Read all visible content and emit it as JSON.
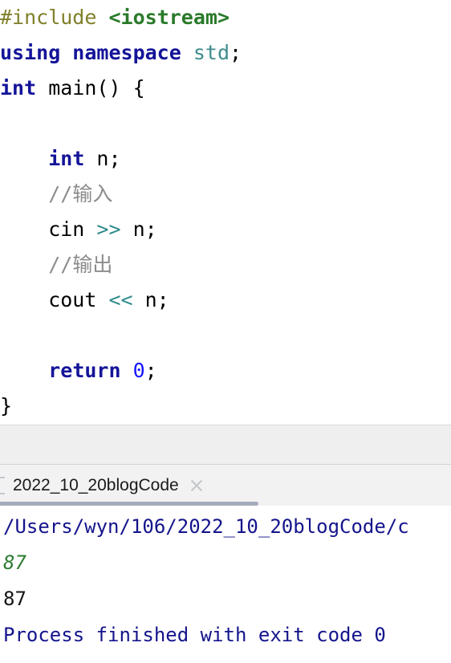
{
  "editor": {
    "language": "C++",
    "lines": [
      {
        "id": "line-include",
        "tokens": [
          {
            "t": "#include",
            "c": "tok-pre"
          },
          {
            "t": " ",
            "c": "tok-plain"
          },
          {
            "t": "<iostream>",
            "c": "tok-header"
          }
        ]
      },
      {
        "id": "line-using",
        "tokens": [
          {
            "t": "using namespace",
            "c": "tok-kw"
          },
          {
            "t": " ",
            "c": "tok-plain"
          },
          {
            "t": "std",
            "c": "tok-ns"
          },
          {
            "t": ";",
            "c": "tok-plain"
          }
        ]
      },
      {
        "id": "line-main",
        "tokens": [
          {
            "t": "int",
            "c": "tok-kw"
          },
          {
            "t": " main() {",
            "c": "tok-plain"
          }
        ]
      },
      {
        "id": "line-blank-1",
        "tokens": [
          {
            "t": " ",
            "c": "tok-plain"
          }
        ]
      },
      {
        "id": "line-decl-n",
        "tokens": [
          {
            "t": "    ",
            "c": "tok-plain"
          },
          {
            "t": "int",
            "c": "tok-kw"
          },
          {
            "t": " n;",
            "c": "tok-plain"
          }
        ]
      },
      {
        "id": "line-comment-input",
        "tokens": [
          {
            "t": "    ",
            "c": "tok-plain"
          },
          {
            "t": "//输入",
            "c": "tok-comment"
          }
        ]
      },
      {
        "id": "line-cin",
        "tokens": [
          {
            "t": "    cin ",
            "c": "tok-plain"
          },
          {
            "t": ">>",
            "c": "tok-op"
          },
          {
            "t": " n;",
            "c": "tok-plain"
          }
        ]
      },
      {
        "id": "line-comment-output",
        "tokens": [
          {
            "t": "    ",
            "c": "tok-plain"
          },
          {
            "t": "//输出",
            "c": "tok-comment"
          }
        ]
      },
      {
        "id": "line-cout",
        "tokens": [
          {
            "t": "    cout ",
            "c": "tok-plain"
          },
          {
            "t": "<<",
            "c": "tok-op"
          },
          {
            "t": " n;",
            "c": "tok-plain"
          }
        ]
      },
      {
        "id": "line-blank-2",
        "tokens": [
          {
            "t": " ",
            "c": "tok-plain"
          }
        ]
      },
      {
        "id": "line-return",
        "tokens": [
          {
            "t": "    ",
            "c": "tok-plain"
          },
          {
            "t": "return",
            "c": "tok-kw"
          },
          {
            "t": " ",
            "c": "tok-plain"
          },
          {
            "t": "0",
            "c": "tok-num"
          },
          {
            "t": ";",
            "c": "tok-plain"
          }
        ]
      },
      {
        "id": "line-close-brace",
        "tokens": [
          {
            "t": "}",
            "c": "tok-plain"
          }
        ]
      }
    ]
  },
  "run_panel": {
    "tab": {
      "label": "2022_10_20blogCode",
      "close_label": "×",
      "active": true
    },
    "console": {
      "lines": [
        {
          "id": "console-command-path",
          "text": "/Users/wyn/106/2022_10_20blogCode/c",
          "kind": "c-path",
          "truncated": true
        },
        {
          "id": "console-user-input",
          "text": "87",
          "kind": "c-input"
        },
        {
          "id": "console-program-output",
          "text": "87",
          "kind": "c-stdout"
        },
        {
          "id": "console-exit-status",
          "text": "Process finished with exit code 0",
          "kind": "c-exit"
        }
      ]
    }
  },
  "colors": {
    "preprocessor": "#80802b",
    "header_string": "#2a7a2a",
    "keyword": "#141499",
    "namespace": "#3f8c8c",
    "comment": "#8c8c8c",
    "operator": "#2e8b8b",
    "number": "#1414ff",
    "console_path": "#14148c",
    "console_input": "#2e7d32",
    "console_stdout": "#151515",
    "tab_underline": "#a4abbd",
    "toolbar_bg": "#efefef"
  }
}
